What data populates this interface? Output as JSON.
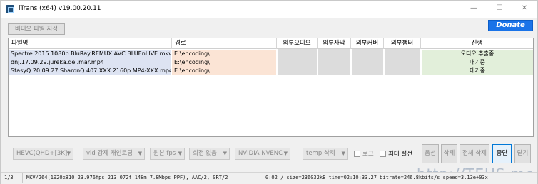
{
  "window": {
    "title": "iTrans (x64) v19.00.20.11",
    "minimize_glyph": "—",
    "maximize_glyph": "☐",
    "close_glyph": "✕"
  },
  "toolbar": {
    "set_video_file_label": "비디오 파일 지정",
    "donate_label": "Donate"
  },
  "grid": {
    "columns": [
      "파일명",
      "경로",
      "외부오디오",
      "외부자막",
      "외부커버",
      "외부챕터",
      "진행"
    ],
    "rows": [
      {
        "file": "Spectre.2015.1080p.BluRay.REMUX.AVC.BLUEnLIVE.mkv",
        "path": "E:\\encoding\\",
        "progress": "오디오 추출중"
      },
      {
        "file": "dnj.17.09.29.jureka.del.mar.mp4",
        "path": "E:\\encoding\\",
        "progress": "대기중"
      },
      {
        "file": "StasyQ.20.09.27.SharonQ.407.XXX.2160p.MP4-XXX.mp4",
        "path": "E:\\encoding\\",
        "progress": "대기중"
      }
    ]
  },
  "controls": {
    "codec": "HEVC(QHD+[3K])",
    "reencode": "vid 강제 재인코딩",
    "fps": "원본 fps",
    "rotation": "회전 없음",
    "encoder": "NVIDIA NVENC",
    "temp": "temp 삭제",
    "log_label": "로그",
    "max_power_label": "최대 절전",
    "options_label": "옵션",
    "delete_label": "삭제",
    "delete_all_label": "전체 삭제",
    "stop_label": "중단",
    "close_label": "닫기"
  },
  "status": {
    "count": "1/3",
    "media_info": "MKV/264(1920x810 23.976fps 213.072f 148m 7.8Mbps PPF), AAC/2, SRT/2",
    "progress_info": "0:02 / size=236032kB time=02:10:33.27 bitrate=246.8kbits/s speed=3.13e+03x"
  },
  "watermark": "http://TEUS.me",
  "icons": {
    "app": "app-icon",
    "dropdown": "chevron-down-icon"
  }
}
